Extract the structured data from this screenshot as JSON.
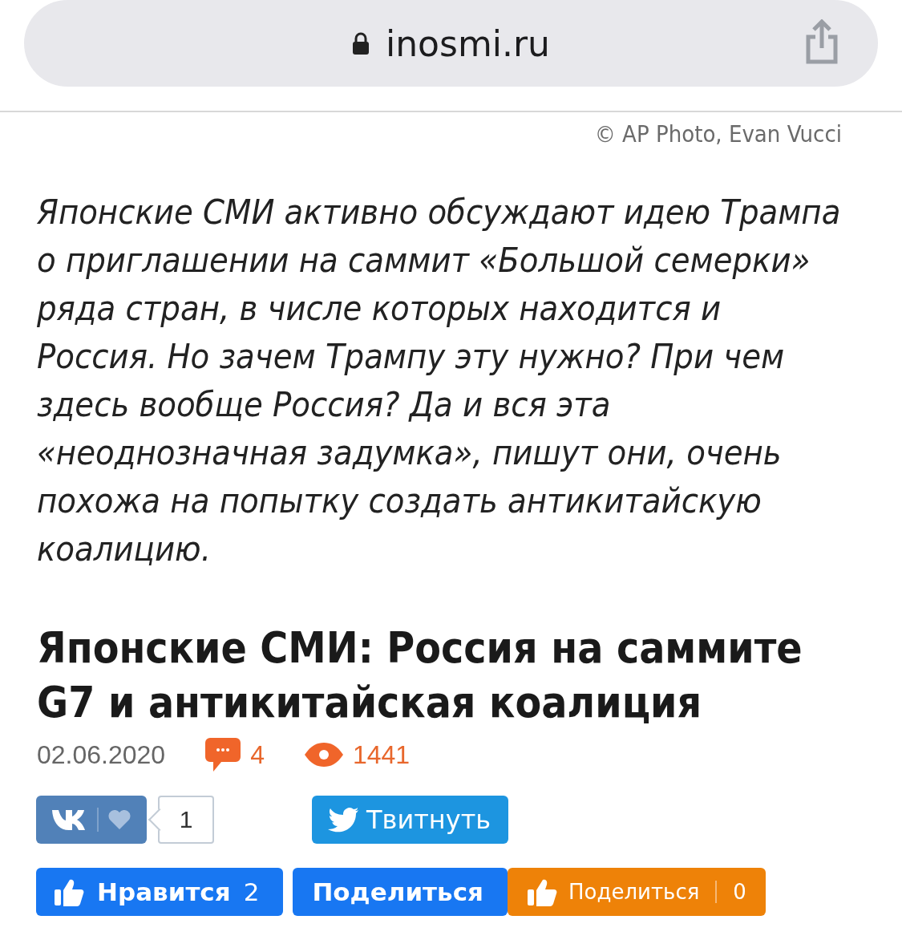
{
  "address_bar": {
    "url": "inosmi.ru"
  },
  "photo_credit": "© AP Photo, Evan Vucci",
  "lead": "Японские СМИ активно обсуждают идею Трампа о приглашении на саммит «Большой семерки» ряда стран, в числе которых находится и Россия. Но зачем Трампу эту нужно? При чем здесь вообще Россия? Да и вся эта «неоднозначная задумка», пишут они, очень похожа на попытку создать антикитайскую коалицию.",
  "headline": "Японские СМИ: Россия на саммите G7 и антикитайская коалиция",
  "meta": {
    "date": "02.06.2020",
    "comments": "4",
    "views": "1441"
  },
  "share_rows": [
    [
      {
        "kind": "vk",
        "count": "1"
      },
      {
        "kind": "twitter",
        "label": "Твитнуть"
      }
    ],
    [
      {
        "kind": "fb-like",
        "label": "Нравится",
        "count": "2"
      },
      {
        "kind": "fb-share",
        "label": "Поделиться"
      },
      {
        "kind": "ok",
        "label": "Поделиться",
        "count": "0"
      }
    ]
  ]
}
